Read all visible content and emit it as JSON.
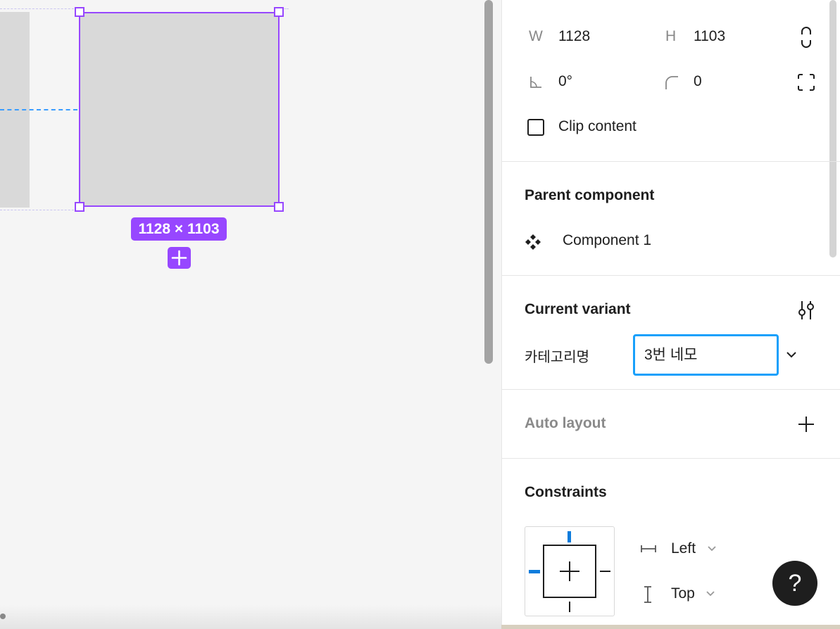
{
  "canvas": {
    "size_label": "1128 × 1103"
  },
  "panel": {
    "dimensions": {
      "w_label": "W",
      "w_value": "1128",
      "h_label": "H",
      "h_value": "1103",
      "rotation_value": "0°",
      "radius_value": "0"
    },
    "clip_content_label": "Clip content",
    "clip_content_checked": false,
    "parent_component": {
      "title": "Parent component",
      "name": "Component 1"
    },
    "current_variant": {
      "title": "Current variant",
      "property_label": "카테고리명",
      "property_value": "3번 네모"
    },
    "auto_layout": {
      "title": "Auto layout"
    },
    "constraints": {
      "title": "Constraints",
      "horizontal": "Left",
      "vertical": "Top"
    },
    "help_label": "?"
  },
  "colors": {
    "selection": "#9747ff",
    "accent_blue": "#18a0fb",
    "guide_blue": "#3b9dff"
  }
}
